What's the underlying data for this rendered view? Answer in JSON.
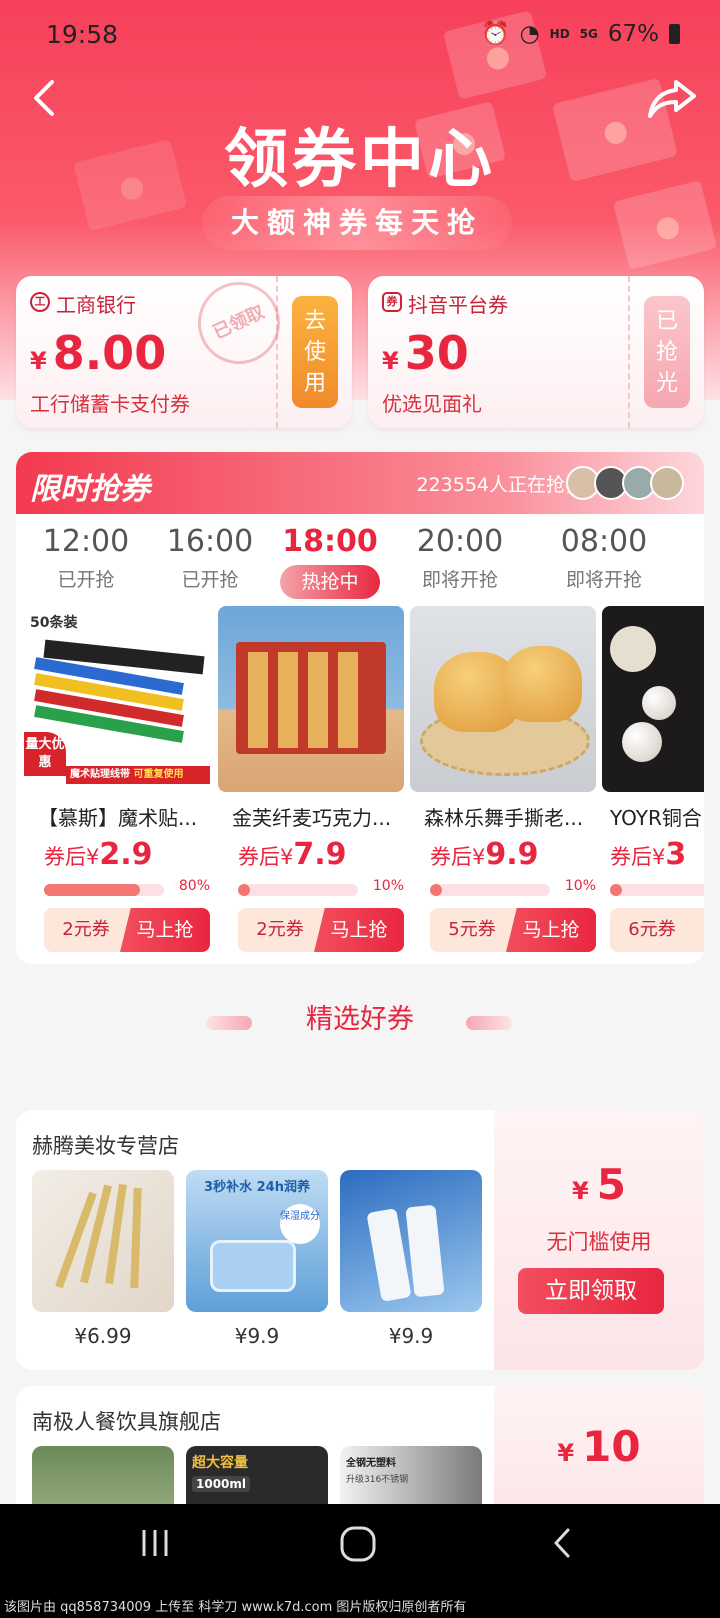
{
  "status_bar": {
    "time": "19:58",
    "network": "HD",
    "signal": "5G",
    "battery": "67%"
  },
  "header": {
    "title": "领券中心",
    "subtitle": "大额神券每天抢"
  },
  "coupons": [
    {
      "issuer": "工商银行",
      "currency": "¥",
      "amount": "8.00",
      "desc": "工行储蓄卡支付券",
      "stamp": "已领取",
      "button": "去使用"
    },
    {
      "issuer": "抖音平台券",
      "currency": "¥",
      "amount": "30",
      "desc": "优选见面礼",
      "button": "已抢光"
    }
  ],
  "limited": {
    "title": "限时抢券",
    "count_text": "223554人正在抢券",
    "slots": [
      {
        "time": "12:00",
        "status": "已开抢"
      },
      {
        "time": "16:00",
        "status": "已开抢"
      },
      {
        "time": "18:00",
        "status": "热抢中"
      },
      {
        "time": "20:00",
        "status": "即将开抢"
      },
      {
        "time": "08:00",
        "status": "即将开抢"
      }
    ],
    "products": [
      {
        "name": "【慕斯】魔术贴...",
        "price_prefix": "券后¥",
        "price": "2.9",
        "progress": 0.8,
        "progress_label": "80%",
        "coupon": "2元券",
        "button": "马上抢",
        "img_badge_top": "50条装",
        "img_badge_corner": "量大优惠",
        "img_banner": "魔术贴理线带",
        "img_banner_sub": "可重复使用"
      },
      {
        "name": "金芙纤麦巧克力...",
        "price_prefix": "券后¥",
        "price": "7.9",
        "progress": 0.1,
        "progress_label": "10%",
        "coupon": "2元券",
        "button": "马上抢"
      },
      {
        "name": "森林乐舞手撕老...",
        "price_prefix": "券后¥",
        "price": "9.9",
        "progress": 0.1,
        "progress_label": "10%",
        "coupon": "5元券",
        "button": "马上抢"
      },
      {
        "name": "YOYR铜合",
        "price_prefix": "券后¥",
        "price": "3",
        "progress": 0.1,
        "progress_label": "",
        "coupon": "6元券",
        "button": ""
      }
    ]
  },
  "featured": {
    "title": "精选好券",
    "stores": [
      {
        "name": "赫腾美妆专营店",
        "prices": [
          "¥6.99",
          "¥9.9",
          "¥9.9"
        ],
        "currency": "¥",
        "amount": "5",
        "condition": "无门槛使用",
        "button": "立即领取",
        "img2_text": "3秒补水 24h润养",
        "img2_badge": "保湿成分"
      },
      {
        "name": "南极人餐饮具旗舰店",
        "currency": "¥",
        "amount": "10",
        "img2_text": "超大容量",
        "img2_sub": "1000ml",
        "img3_text": "全钢无塑料",
        "img3_sub": "升级316不锈钢"
      }
    ]
  },
  "watermark": "该图片由 qq858734009 上传至 科学刀 www.k7d.com 图片版权归原创者所有",
  "colors": {
    "accent": "#e8263f",
    "header": "#f7405a"
  }
}
